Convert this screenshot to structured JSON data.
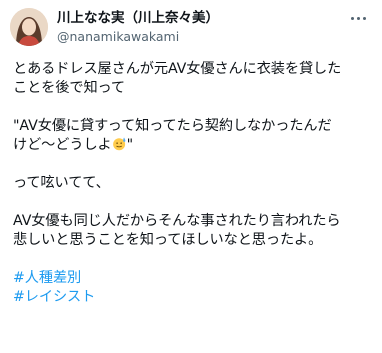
{
  "author": {
    "display_name": "川上なな実（川上奈々美）",
    "handle": "@nanamikawakami"
  },
  "tweet": {
    "paragraphs": [
      "とあるドレス屋さんが元AV女優さんに衣装を貸した\nことを後で知って",
      "\"AV女優に貸すって知ってたら契約しなかったんだ\nけど〜どうしよ",
      "って呟いてて、",
      "AV女優も同じ人だからそんな事されたり言われたら\n悲しいと思うことを知ってほしいなと思ったよ。"
    ],
    "quote_close": "\"",
    "emoji": "grimacing-sweat-face-emoji",
    "hashtags": [
      "#人種差別",
      "#レイシスト"
    ]
  },
  "colors": {
    "text": "#0f1419",
    "secondary": "#536471",
    "link": "#1d9bf0"
  }
}
